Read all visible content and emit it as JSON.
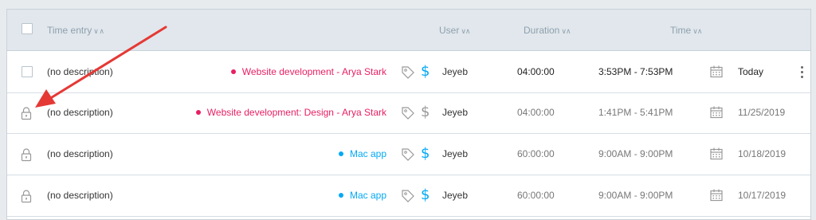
{
  "header": {
    "time_entry": "Time entry",
    "user": "User",
    "duration": "Duration",
    "time": "Time"
  },
  "rows": [
    {
      "description": "(no description)",
      "project": "Website development - Arya Stark",
      "project_color": "#e91e63",
      "billable": true,
      "user": "Jeyeb",
      "duration": "04:00:00",
      "start": "3:53PM",
      "end": "7:53PM",
      "date": "Today",
      "locked": false
    },
    {
      "description": "(no description)",
      "project": "Website development: Design - Arya Stark",
      "project_color": "#e91e63",
      "billable": false,
      "user": "Jeyeb",
      "duration": "04:00:00",
      "start": "1:41PM",
      "end": "5:41PM",
      "date": "11/25/2019",
      "locked": true
    },
    {
      "description": "(no description)",
      "project": "Mac app",
      "project_color": "#03a9f4",
      "billable": true,
      "user": "Jeyeb",
      "duration": "60:00:00",
      "start": "9:00AM",
      "end": "9:00PM",
      "date": "10/18/2019",
      "locked": true
    },
    {
      "description": "(no description)",
      "project": "Mac app",
      "project_color": "#03a9f4",
      "billable": true,
      "user": "Jeyeb",
      "duration": "60:00:00",
      "start": "9:00AM",
      "end": "9:00PM",
      "date": "10/17/2019",
      "locked": true
    }
  ],
  "time_separator": "-",
  "billable_symbol": "$",
  "annotation": {
    "color": "#e53935"
  }
}
